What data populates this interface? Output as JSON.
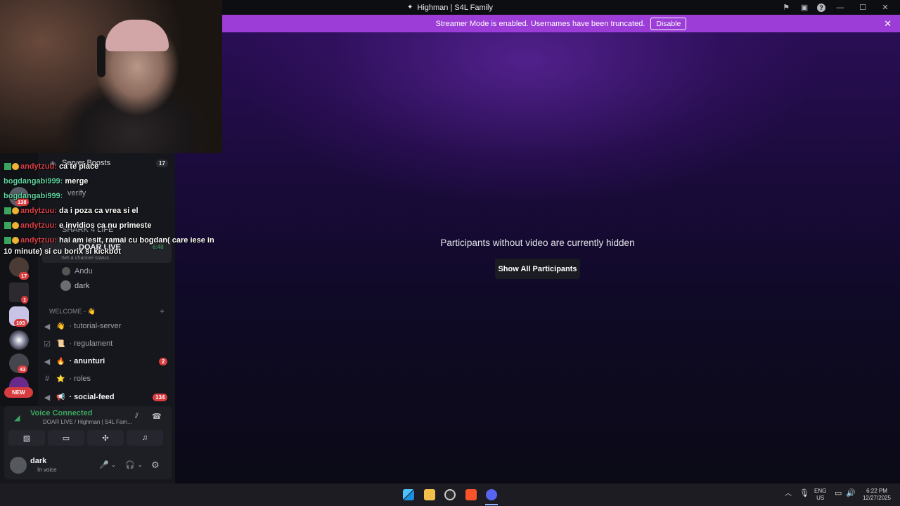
{
  "window": {
    "title": "Highman | S4L Family"
  },
  "banner": {
    "text": "Streamer Mode is enabled. Usernames have been truncated.",
    "button": "Disable"
  },
  "stage": {
    "message": "Participants without video are currently hidden",
    "button": "Show All Participants"
  },
  "sidebar": {
    "server_boosts": {
      "label": "Server Boosts",
      "count": "17"
    },
    "channels_top": [
      {
        "label": "verify"
      },
      {
        "label": "SHARK 4 LIFE"
      },
      {
        "label": "DOAR LIVE",
        "time": "6:48"
      }
    ],
    "channel_status_hint": "Set a channel status",
    "voice_members": [
      "Andu",
      "dark"
    ],
    "category": "WELCOME - 👋",
    "channels": [
      {
        "label": "· tutorial-server",
        "emoji": "👋"
      },
      {
        "label": "· regulament",
        "emoji": "📜"
      },
      {
        "label": "· anunturi",
        "emoji": "🔥",
        "badge": "2"
      },
      {
        "label": "· roles",
        "emoji": "⭐"
      },
      {
        "label": "· social-feed",
        "emoji": "📢",
        "badge": "134"
      }
    ],
    "server_badges": [
      "138",
      "17",
      "1",
      "103",
      "43",
      "NEW"
    ]
  },
  "chat_overlay": [
    {
      "user": "andytzuu:",
      "text": "ca te place"
    },
    {
      "user": "bogdangabi999:",
      "text": "merge"
    },
    {
      "user": "bogdangabi999:",
      "text": ""
    },
    {
      "user": "andytzuu:",
      "text": "da i poza ca vrea si el"
    },
    {
      "user": "andytzuu:",
      "text": "e invidios ca nu primeste"
    },
    {
      "user": "andytzuu:",
      "text": "hai am iesit, ramai cu bogdan( care iese in"
    },
    {
      "user": "",
      "text": "10 minute) si cu borix si kickbot"
    }
  ],
  "voice": {
    "status": "Voice Connected",
    "location": "DOAR LIVE / Highman | S4L Fam...",
    "user": "dark",
    "user_status": "In voice"
  },
  "taskbar": {
    "lang_top": "ENG",
    "lang_bottom": "US",
    "time": "6:22 PM",
    "date": "12/27/2025"
  },
  "colors": {
    "banner": "#9b3dd6",
    "voice_green": "#3ba55d",
    "badge_red": "#d83c3e"
  }
}
